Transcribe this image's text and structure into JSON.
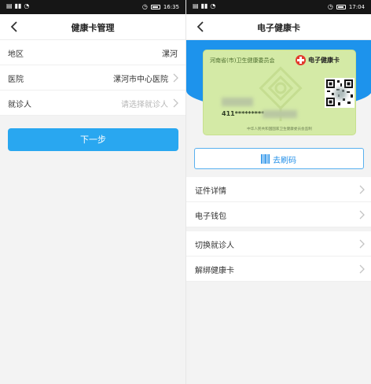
{
  "left": {
    "status": {
      "time": "16:35"
    },
    "title": "健康卡管理",
    "rows": [
      {
        "label": "地区",
        "value": "漯河",
        "placeholder": false
      },
      {
        "label": "医院",
        "value": "漯河市中心医院",
        "placeholder": false
      },
      {
        "label": "就诊人",
        "value": "请选择就诊人",
        "placeholder": true
      }
    ],
    "next_label": "下一步"
  },
  "right": {
    "status": {
      "time": "17:04"
    },
    "title": "电子健康卡",
    "card": {
      "issuer": "河南省(市)卫生健康委员会",
      "logo_text": "电子健康卡",
      "id_prefix": "411*********",
      "footer": "中华人民共和国国家卫生健康委员会监制"
    },
    "swipe_label": "去刷码",
    "rows": [
      "证件详情",
      "电子钱包",
      "切换就诊人",
      "解绑健康卡"
    ]
  },
  "colors": {
    "accent": "#29a7f0",
    "hero": "#1d93ec",
    "card": "#d4eaa6"
  }
}
